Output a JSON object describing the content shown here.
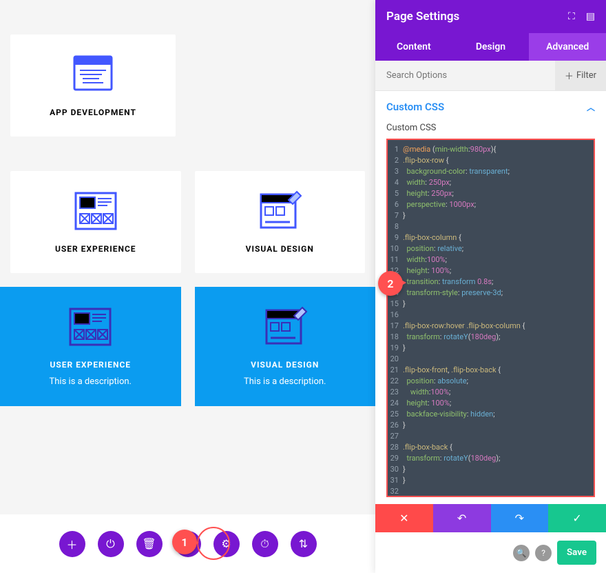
{
  "cards": {
    "app_dev": {
      "title": "APP DEVELOPMENT"
    },
    "ux1": {
      "title": "USER EXPERIENCE"
    },
    "vd1": {
      "title": "VISUAL DESIGN"
    },
    "ux2": {
      "title": "USER EXPERIENCE",
      "desc": "This is a description."
    },
    "vd2": {
      "title": "VISUAL DESIGN",
      "desc": "This is a description."
    }
  },
  "panel": {
    "title": "Page Settings",
    "tabs": {
      "content": "Content",
      "design": "Design",
      "advanced": "Advanced",
      "active": "advanced"
    },
    "search_placeholder": "Search Options",
    "filter_label": "Filter",
    "section": "Custom CSS",
    "css_label": "Custom CSS",
    "save": "Save"
  },
  "callouts": {
    "c1": "1",
    "c2": "2"
  },
  "css_code": [
    {
      "n": 1,
      "html": "<span class='k'>@media</span> <span class='p'>(</span><span class='c'>min-width</span><span class='p'>:</span><span class='v'>980px</span><span class='p'>){</span>"
    },
    {
      "n": 2,
      "html": "<span class='s'>.flip-box-row</span> <span class='p'>{</span>"
    },
    {
      "n": 3,
      "html": "  <span class='c'>background-color</span><span class='p'>:</span> <span class='u'>transparent</span><span class='p'>;</span>"
    },
    {
      "n": 4,
      "html": "  <span class='c'>width</span><span class='p'>:</span> <span class='v'>250px</span><span class='p'>;</span>"
    },
    {
      "n": 5,
      "html": "  <span class='c'>height</span><span class='p'>:</span> <span class='v'>250px</span><span class='p'>;</span>"
    },
    {
      "n": 6,
      "html": "  <span class='c'>perspective</span><span class='p'>:</span> <span class='v'>1000px</span><span class='p'>;</span>"
    },
    {
      "n": 7,
      "html": "<span class='p'>}</span>"
    },
    {
      "n": 8,
      "html": ""
    },
    {
      "n": 9,
      "html": "<span class='s'>.flip-box-column</span> <span class='p'>{</span>"
    },
    {
      "n": 10,
      "html": "  <span class='c'>position</span><span class='p'>:</span> <span class='u'>relative</span><span class='p'>;</span>"
    },
    {
      "n": 11,
      "html": "  <span class='c'>width</span><span class='p'>:</span><span class='v'>100%</span><span class='p'>;</span>"
    },
    {
      "n": 12,
      "html": "  <span class='c'>height</span><span class='p'>:</span> <span class='v'>100%</span><span class='p'>;</span>"
    },
    {
      "n": 13,
      "html": "  <span class='c'>transition</span><span class='p'>:</span> <span class='u'>transform</span> <span class='v'>0.8s</span><span class='p'>;</span>"
    },
    {
      "n": 14,
      "html": "  <span class='c'>transform-style</span><span class='p'>:</span> <span class='u'>preserve-3d</span><span class='p'>;</span>"
    },
    {
      "n": 15,
      "html": "<span class='p'>}</span>"
    },
    {
      "n": 16,
      "html": ""
    },
    {
      "n": 17,
      "html": "<span class='s'>.flip-box-row:hover .flip-box-column</span> <span class='p'>{</span>"
    },
    {
      "n": 18,
      "html": "  <span class='c'>transform</span><span class='p'>:</span> <span class='u'>rotateY</span><span class='p'>(</span><span class='v'>180deg</span><span class='p'>);</span>"
    },
    {
      "n": 19,
      "html": "<span class='p'>}</span>"
    },
    {
      "n": 20,
      "html": ""
    },
    {
      "n": 21,
      "html": "<span class='s'>.flip-box-front</span><span class='p'>,</span> <span class='s'>.flip-box-back</span> <span class='p'>{</span>"
    },
    {
      "n": 22,
      "html": "  <span class='c'>position</span><span class='p'>:</span> <span class='u'>absolute</span><span class='p'>;</span>"
    },
    {
      "n": 23,
      "html": "    <span class='c'>width</span><span class='p'>:</span><span class='v'>100%</span><span class='p'>;</span>"
    },
    {
      "n": 24,
      "html": "  <span class='c'>height</span><span class='p'>:</span> <span class='v'>100%</span><span class='p'>;</span>"
    },
    {
      "n": 25,
      "html": "  <span class='c'>backface-visibility</span><span class='p'>:</span> <span class='u'>hidden</span><span class='p'>;</span>"
    },
    {
      "n": 26,
      "html": "<span class='p'>}</span>"
    },
    {
      "n": 27,
      "html": ""
    },
    {
      "n": 28,
      "html": "<span class='s'>.flip-box-back</span> <span class='p'>{</span>"
    },
    {
      "n": 29,
      "html": "  <span class='c'>transform</span><span class='p'>:</span> <span class='u'>rotateY</span><span class='p'>(</span><span class='v'>180deg</span><span class='p'>);</span>"
    },
    {
      "n": 30,
      "html": "<span class='p'>}</span>"
    },
    {
      "n": 31,
      "html": "<span class='p'>}</span>"
    },
    {
      "n": 32,
      "html": ""
    }
  ]
}
